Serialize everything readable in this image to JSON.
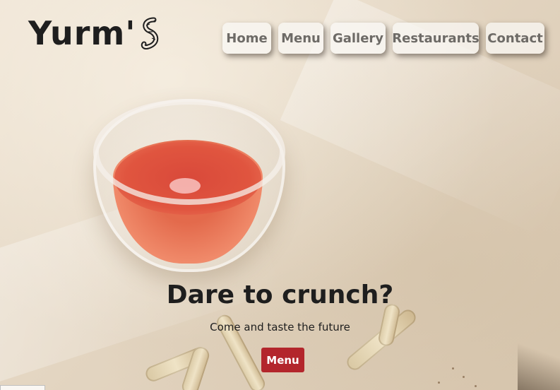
{
  "brand": {
    "logo_text": "Yurm'",
    "logo_icon": "worm-icon"
  },
  "nav": {
    "items": [
      {
        "label": "Home"
      },
      {
        "label": "Menu"
      },
      {
        "label": "Gallery"
      },
      {
        "label": "Restaurants"
      },
      {
        "label": "Contact"
      }
    ]
  },
  "hero": {
    "headline": "Dare to crunch?",
    "subheadline": "Come and taste the future",
    "cta_label": "Menu"
  },
  "colors": {
    "cta_background": "#b3262c",
    "nav_text": "#6d6a66",
    "headline_text": "#1e1e1e"
  }
}
